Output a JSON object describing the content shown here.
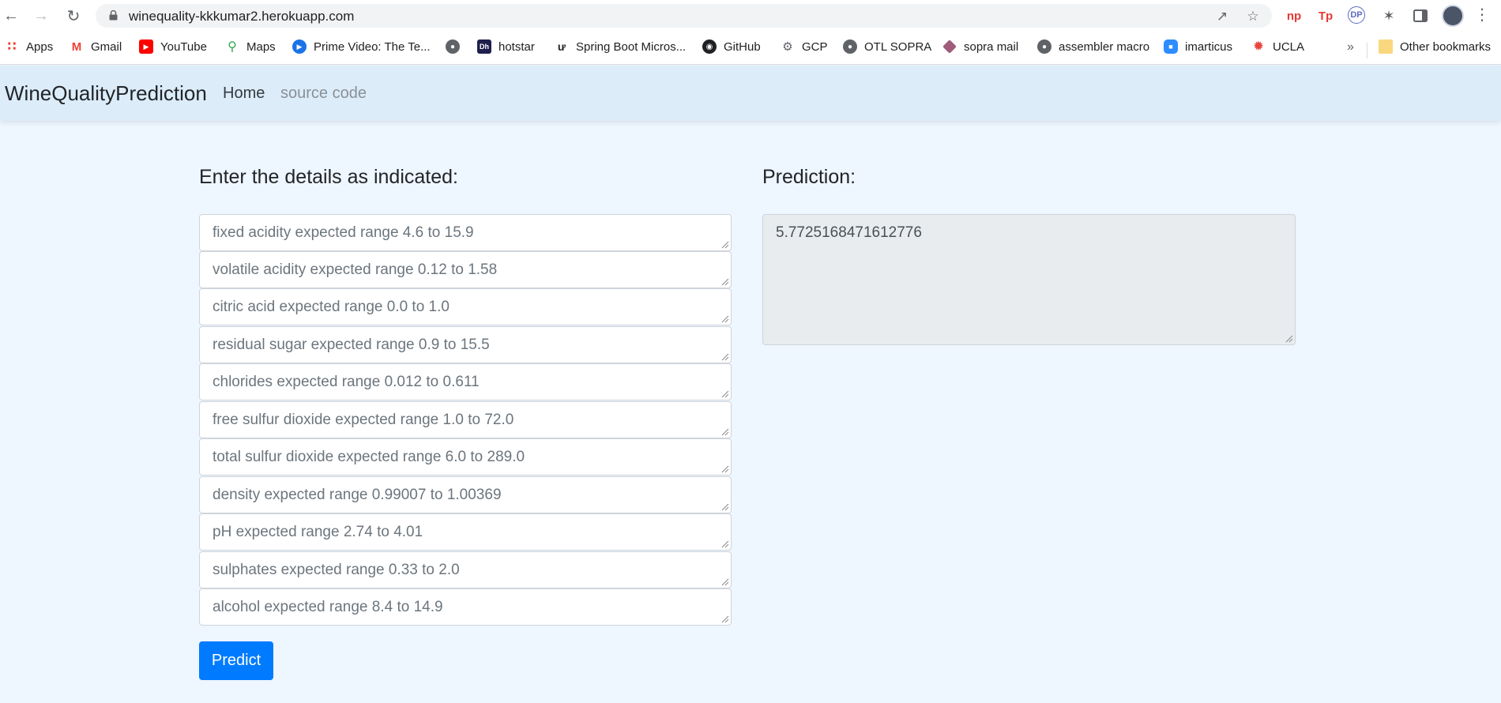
{
  "browser": {
    "url": "winequality-kkkumar2.herokuapp.com",
    "bookmarks": [
      {
        "label": "Apps",
        "icon": "apps-grid-icon",
        "color": "#ea4335"
      },
      {
        "label": "Gmail",
        "icon": "gmail-icon",
        "color": "#ea4335"
      },
      {
        "label": "YouTube",
        "icon": "youtube-icon",
        "color": "#ff0000"
      },
      {
        "label": "Maps",
        "icon": "maps-pin-icon",
        "color": "#34a853"
      },
      {
        "label": "Prime Video: The Te...",
        "icon": "prime-video-icon",
        "color": "#1a73e8"
      },
      {
        "label": "",
        "icon": "globe-icon",
        "color": "#5f6368"
      },
      {
        "label": "hotstar",
        "icon": "hotstar-icon",
        "color": "#1f1f4e"
      },
      {
        "label": "Spring Boot Micros...",
        "icon": "spring-icon",
        "color": "#202124"
      },
      {
        "label": "GitHub",
        "icon": "github-icon",
        "color": "#202124"
      },
      {
        "label": "GCP",
        "icon": "gcp-icon",
        "color": "#5f6368"
      },
      {
        "label": "OTL SOPRA",
        "icon": "globe-icon",
        "color": "#5f6368"
      },
      {
        "label": "sopra mail",
        "icon": "sopra-icon",
        "color": "#a05c7b"
      },
      {
        "label": "assembler macro",
        "icon": "globe-icon",
        "color": "#5f6368"
      },
      {
        "label": "imarticus",
        "icon": "zoom-icon",
        "color": "#2d8cff"
      },
      {
        "label": "UCLA",
        "icon": "ucla-icon",
        "color": "#e8453c"
      }
    ],
    "more_bookmarks": "»",
    "other_bookmarks": "Other bookmarks"
  },
  "navbar": {
    "brand": "WineQualityPrediction",
    "links": [
      "Home",
      "source code"
    ]
  },
  "form": {
    "heading": "Enter the details as indicated:",
    "fields": [
      "fixed acidity expected range 4.6 to 15.9",
      "volatile acidity expected range 0.12 to 1.58",
      "citric acid expected range 0.0 to 1.0",
      "residual sugar expected range 0.9 to 15.5",
      "chlorides expected range 0.012 to 0.611",
      "free sulfur dioxide expected range 1.0 to 72.0",
      "total sulfur dioxide expected range 6.0 to 289.0",
      "density expected range 0.99007 to 1.00369",
      "pH expected range 2.74 to 4.01",
      "sulphates expected range 0.33 to 2.0",
      "alcohol expected range 8.4 to 14.9"
    ],
    "button": "Predict"
  },
  "prediction": {
    "heading": "Prediction:",
    "value": "5.7725168471612776"
  },
  "colors": {
    "primary": "#007bff",
    "navbar_bg": "#dcecf9",
    "page_bg": "#eef6ff"
  }
}
